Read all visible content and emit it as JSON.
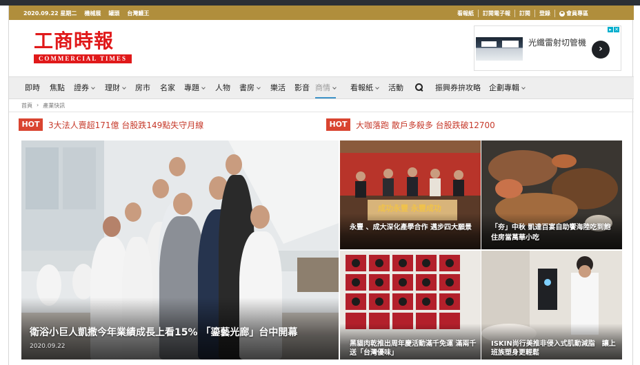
{
  "utility_bar": {
    "left_items": [
      "2020.09.22 星期二",
      "機械展",
      "罐頭",
      "台灣鰻王"
    ],
    "right_items": [
      "看報紙",
      "訂閱電子報",
      "訂閱",
      "登錄"
    ],
    "member_label": "會員專區"
  },
  "header": {
    "logo_cn": "工商時報",
    "logo_en": "COMMERCIAL    TIMES",
    "ad_text": "光纖雷射切管機",
    "ad_button": "›",
    "ad_choice_icons": [
      "adchoices-icon",
      "close-icon"
    ]
  },
  "nav": {
    "items": [
      {
        "label": "即時",
        "dropdown": false,
        "active": false
      },
      {
        "label": "焦點",
        "dropdown": false,
        "active": false
      },
      {
        "label": "證券",
        "dropdown": true,
        "active": false
      },
      {
        "label": "理財",
        "dropdown": true,
        "active": false
      },
      {
        "label": "房市",
        "dropdown": false,
        "active": false
      },
      {
        "label": "名家",
        "dropdown": false,
        "active": false
      },
      {
        "label": "專題",
        "dropdown": true,
        "active": false
      },
      {
        "label": "人物",
        "dropdown": false,
        "active": false
      },
      {
        "label": "書房",
        "dropdown": true,
        "active": false
      },
      {
        "label": "樂活",
        "dropdown": false,
        "active": false
      },
      {
        "label": "影音",
        "dropdown": false,
        "active": false
      },
      {
        "label": "商情",
        "dropdown": true,
        "active": true
      },
      {
        "label": "看報紙",
        "dropdown": true,
        "active": false
      },
      {
        "label": "活動",
        "dropdown": false,
        "active": false
      },
      {
        "label": "振興券拚攻略",
        "dropdown": false,
        "active": false
      },
      {
        "label": "企劃專輯",
        "dropdown": true,
        "active": false
      }
    ],
    "search_icon": "search-icon",
    "accent_color": "#3d93c9"
  },
  "breadcrumb": {
    "home": "首頁",
    "separator": "›",
    "current": "產業快訊"
  },
  "hot_news": [
    {
      "badge": "HOT",
      "title": "3大法人賣超171億 台股跌149點失守月線"
    },
    {
      "badge": "HOT",
      "title": "大咖落跑 散戶多殺多 台股跌破12700"
    }
  ],
  "hero": {
    "title": "衛浴小巨人凱撒今年業績成長上看15% 「鎏藝光廊」台中開幕",
    "date": "2020.09.22"
  },
  "tiles": [
    {
      "title": "永豐 、成大深化產學合作 邁步四大願景",
      "sign_text": "成功永豐 永豐成功"
    },
    {
      "title": "「夯」中秋 凱達百宴自助饗海陸吃到飽 住房當萬華小吃"
    },
    {
      "title": "黑貓肉乾推出周年慶活動滿千免運 滿兩千送「台灣優味」"
    },
    {
      "title": "ISKIN尚行美推非侵入式肌動減脂　讓上班族塑身更輕鬆"
    }
  ],
  "colors": {
    "utility_bar": "#b08e3c",
    "logo_red": "#e0191a",
    "hot_red": "#d94430",
    "hot_text": "#c6392a"
  }
}
